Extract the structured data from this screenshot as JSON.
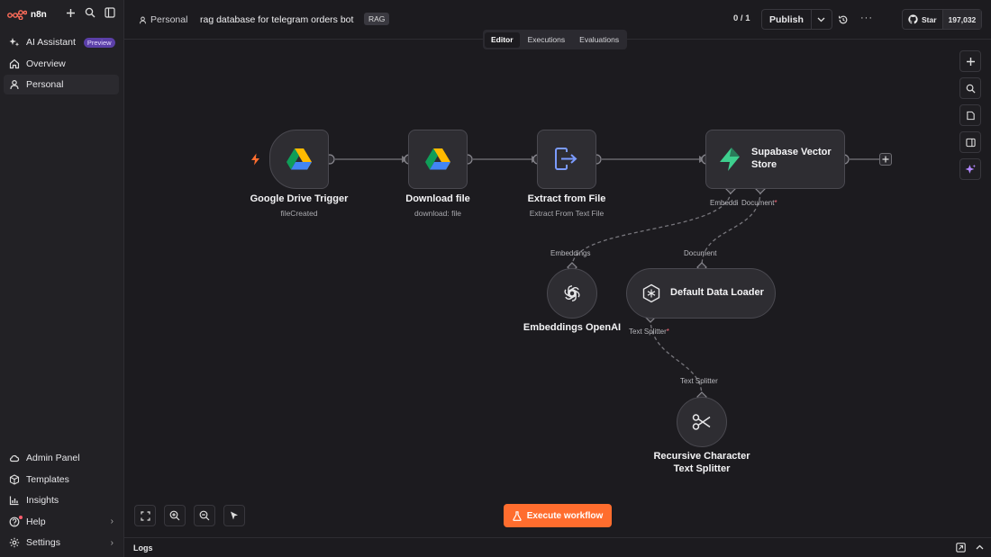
{
  "brand": {
    "name": "n8n"
  },
  "sidebar": {
    "top_items": [
      {
        "label": "AI Assistant",
        "badge": "Preview",
        "icon": "sparkle-icon"
      },
      {
        "label": "Overview",
        "icon": "home-icon"
      },
      {
        "label": "Personal",
        "icon": "user-icon"
      }
    ],
    "bottom_items": [
      {
        "label": "Admin Panel",
        "icon": "cloud-icon"
      },
      {
        "label": "Templates",
        "icon": "box-icon"
      },
      {
        "label": "Insights",
        "icon": "chart-icon"
      },
      {
        "label": "Help",
        "icon": "help-icon"
      },
      {
        "label": "Settings",
        "icon": "gear-icon"
      }
    ]
  },
  "header": {
    "breadcrumb": "Personal",
    "workflow_title": "rag database for telegram orders bot",
    "tag": "RAG",
    "counter": "0 / 1",
    "publish_label": "Publish",
    "github_star_label": "Star",
    "github_star_count": "197,032"
  },
  "tabs": [
    {
      "label": "Editor",
      "active": true
    },
    {
      "label": "Executions",
      "active": false
    },
    {
      "label": "Evaluations",
      "active": false
    }
  ],
  "nodes": {
    "google_drive_trigger": {
      "label": "Google Drive Trigger",
      "sub": "fileCreated"
    },
    "download_file": {
      "label": "Download file",
      "sub": "download: file"
    },
    "extract_from_file": {
      "label": "Extract from File",
      "sub": "Extract From Text File"
    },
    "supabase": {
      "label_line1": "Supabase Vector",
      "label_line2": "Store",
      "port_embedding": "Embeddi",
      "port_document": "Document",
      "required_mark": "*"
    },
    "embeddings_openai": {
      "label": "Embeddings OpenAI",
      "port_top": "Embeddings"
    },
    "default_data_loader": {
      "label": "Default Data Loader",
      "port_top": "Document",
      "port_bottom": "Text Splitter",
      "required_mark": "*"
    },
    "text_splitter": {
      "label_line1": "Recursive Character",
      "label_line2": "Text Splitter",
      "port_top": "Text Splitter"
    }
  },
  "execute_button": "Execute workflow",
  "logs_label": "Logs",
  "colors": {
    "accent": "#ff6d2e",
    "supabase": "#3ecf8e",
    "preview_badge": "#5b3fa8"
  }
}
